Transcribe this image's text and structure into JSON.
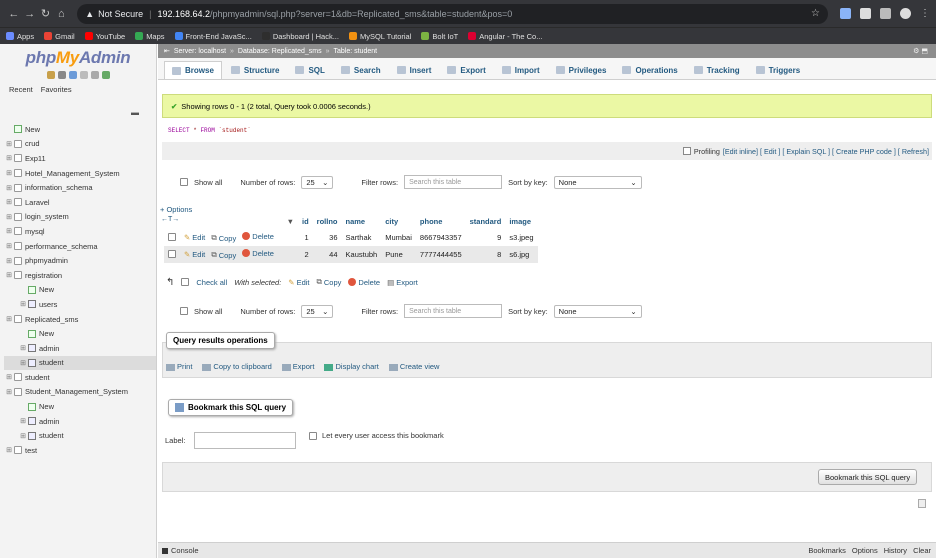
{
  "browser": {
    "security_label": "Not Secure",
    "url_host": "192.168.64.2",
    "url_path": "/phpmyadmin/sql.php?server=1&db=Replicated_sms&table=student&pos=0",
    "bookmarks": [
      {
        "label": "Apps",
        "color": "#6b8cff"
      },
      {
        "label": "Gmail",
        "color": "#ea4335"
      },
      {
        "label": "YouTube",
        "color": "#ff0000"
      },
      {
        "label": "Maps",
        "color": "#34a853"
      },
      {
        "label": "Front-End JavaSc...",
        "color": "#4285f4"
      },
      {
        "label": "Dashboard | Hack...",
        "color": "#2e2e2e"
      },
      {
        "label": "MySQL Tutorial",
        "color": "#f29111"
      },
      {
        "label": "Bolt IoT",
        "color": "#7cb342"
      },
      {
        "label": "Angular - The Co...",
        "color": "#dd0031"
      }
    ]
  },
  "nav": {
    "logo_php": "php",
    "logo_my": "My",
    "logo_admin": "Admin",
    "recent": "Recent",
    "favorites": "Favorites",
    "tree": [
      {
        "label": "New",
        "type": "new",
        "level": 0
      },
      {
        "label": "crud",
        "type": "db",
        "level": 0
      },
      {
        "label": "Exp11",
        "type": "db",
        "level": 0
      },
      {
        "label": "Hotel_Management_System",
        "type": "db",
        "level": 0
      },
      {
        "label": "information_schema",
        "type": "db",
        "level": 0
      },
      {
        "label": "Laravel",
        "type": "db",
        "level": 0
      },
      {
        "label": "login_system",
        "type": "db",
        "level": 0
      },
      {
        "label": "mysql",
        "type": "db",
        "level": 0
      },
      {
        "label": "performance_schema",
        "type": "db",
        "level": 0
      },
      {
        "label": "phpmyadmin",
        "type": "db",
        "level": 0
      },
      {
        "label": "registration",
        "type": "db",
        "level": 0
      },
      {
        "label": "New",
        "type": "new",
        "level": 1
      },
      {
        "label": "users",
        "type": "table",
        "level": 1
      },
      {
        "label": "Replicated_sms",
        "type": "db",
        "level": 0
      },
      {
        "label": "New",
        "type": "new",
        "level": 1
      },
      {
        "label": "admin",
        "type": "table",
        "level": 1
      },
      {
        "label": "student",
        "type": "table",
        "level": 1,
        "selected": true
      },
      {
        "label": "student",
        "type": "db",
        "level": 0
      },
      {
        "label": "Student_Management_System",
        "type": "db",
        "level": 0
      },
      {
        "label": "New",
        "type": "new",
        "level": 1
      },
      {
        "label": "admin",
        "type": "table",
        "level": 1
      },
      {
        "label": "student",
        "type": "table",
        "level": 1
      },
      {
        "label": "test",
        "type": "db",
        "level": 0
      }
    ]
  },
  "breadcrumb": {
    "server": "Server: localhost",
    "database": "Database: Replicated_sms",
    "table": "Table: student"
  },
  "tabs": [
    "Browse",
    "Structure",
    "SQL",
    "Search",
    "Insert",
    "Export",
    "Import",
    "Privileges",
    "Operations",
    "Tracking",
    "Triggers"
  ],
  "message": "Showing rows 0 - 1 (2 total, Query took 0.0006 seconds.)",
  "sql": {
    "kw1": "SELECT",
    "star": "*",
    "kw2": "FROM",
    "table": "`student`"
  },
  "profiling": {
    "label": "Profiling",
    "links": "[Edit inline] [ Edit ] [ Explain SQL ] [ Create PHP code ] [ Refresh]"
  },
  "nav_controls": {
    "show_all": "Show all",
    "rows_label": "Number of rows:",
    "rows_value": "25",
    "filter_label": "Filter rows:",
    "filter_placeholder": "Search this table",
    "sort_label": "Sort by key:",
    "sort_value": "None"
  },
  "results": {
    "options": "+ Options",
    "arrows": "←T→",
    "columns": [
      "id",
      "rollno",
      "name",
      "city",
      "phone",
      "standard",
      "image"
    ],
    "edit": "Edit",
    "copy": "Copy",
    "delete": "Delete",
    "rows": [
      [
        "1",
        "36",
        "Sarthak",
        "Mumbai",
        "8667943357",
        "9",
        "s3.jpeg"
      ],
      [
        "2",
        "44",
        "Kaustubh",
        "Pune",
        "7777444455",
        "8",
        "s6.jpg"
      ]
    ]
  },
  "with_selected": {
    "check_all": "Check all",
    "label": "With selected:",
    "edit": "Edit",
    "copy": "Copy",
    "delete": "Delete",
    "export": "Export"
  },
  "query_ops": {
    "legend": "Query results operations",
    "print": "Print",
    "copy": "Copy to clipboard",
    "export": "Export",
    "chart": "Display chart",
    "view": "Create view"
  },
  "bookmark": {
    "legend": "Bookmark this SQL query",
    "label": "Label:",
    "every_user": "Let every user access this bookmark",
    "button": "Bookmark this SQL query"
  },
  "console": {
    "label": "Console",
    "links": [
      "Bookmarks",
      "Options",
      "History",
      "Clear"
    ]
  }
}
